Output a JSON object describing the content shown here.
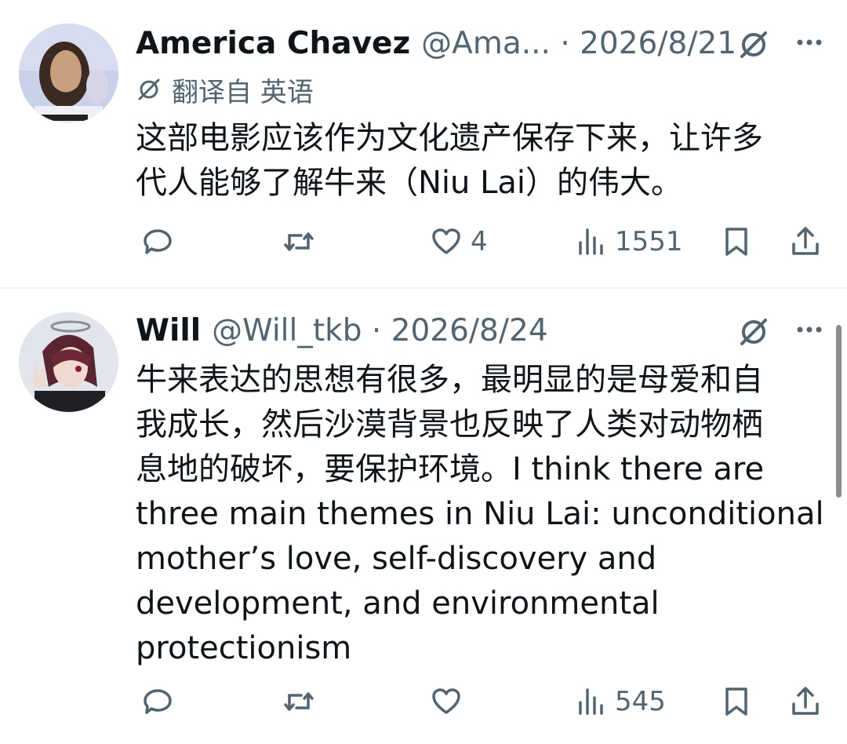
{
  "tweets": [
    {
      "name": "America Chavez",
      "meta": "@Ama... · 2026/8/21",
      "translated_label": "翻译自 英语",
      "text": "这部电影应该作为文化遗产保存下来，让许多\n代人能够了解牛来（Niu Lai）的伟大。",
      "actions": {
        "reply": "",
        "retweet": "",
        "like": "4",
        "views": "1551"
      }
    },
    {
      "name": "Will",
      "meta": "@Will_tkb · 2026/8/24",
      "text": "牛来表达的思想有很多，最明显的是母爱和自\n我成长，然后沙漠背景也反映了人类对动物栖\n息地的破坏，要保护环境。I think there are\nthree main themes in Niu Lai: unconditional\nmother’s love, self-discovery and\ndevelopment, and environmental\nprotectionism",
      "actions": {
        "reply": "",
        "retweet": "",
        "like": "",
        "views": "545"
      }
    }
  ],
  "icons": {
    "reply": "reply-icon",
    "retweet": "retweet-icon",
    "like": "heart-icon",
    "views": "views-bar-chart-icon",
    "bookmark": "bookmark-icon",
    "share": "share-icon",
    "grok": "grok-icon",
    "more": "more-dots-icon"
  },
  "colors": {
    "text": "#0f1419",
    "secondary": "#536471",
    "divider": "#eff3f4"
  }
}
